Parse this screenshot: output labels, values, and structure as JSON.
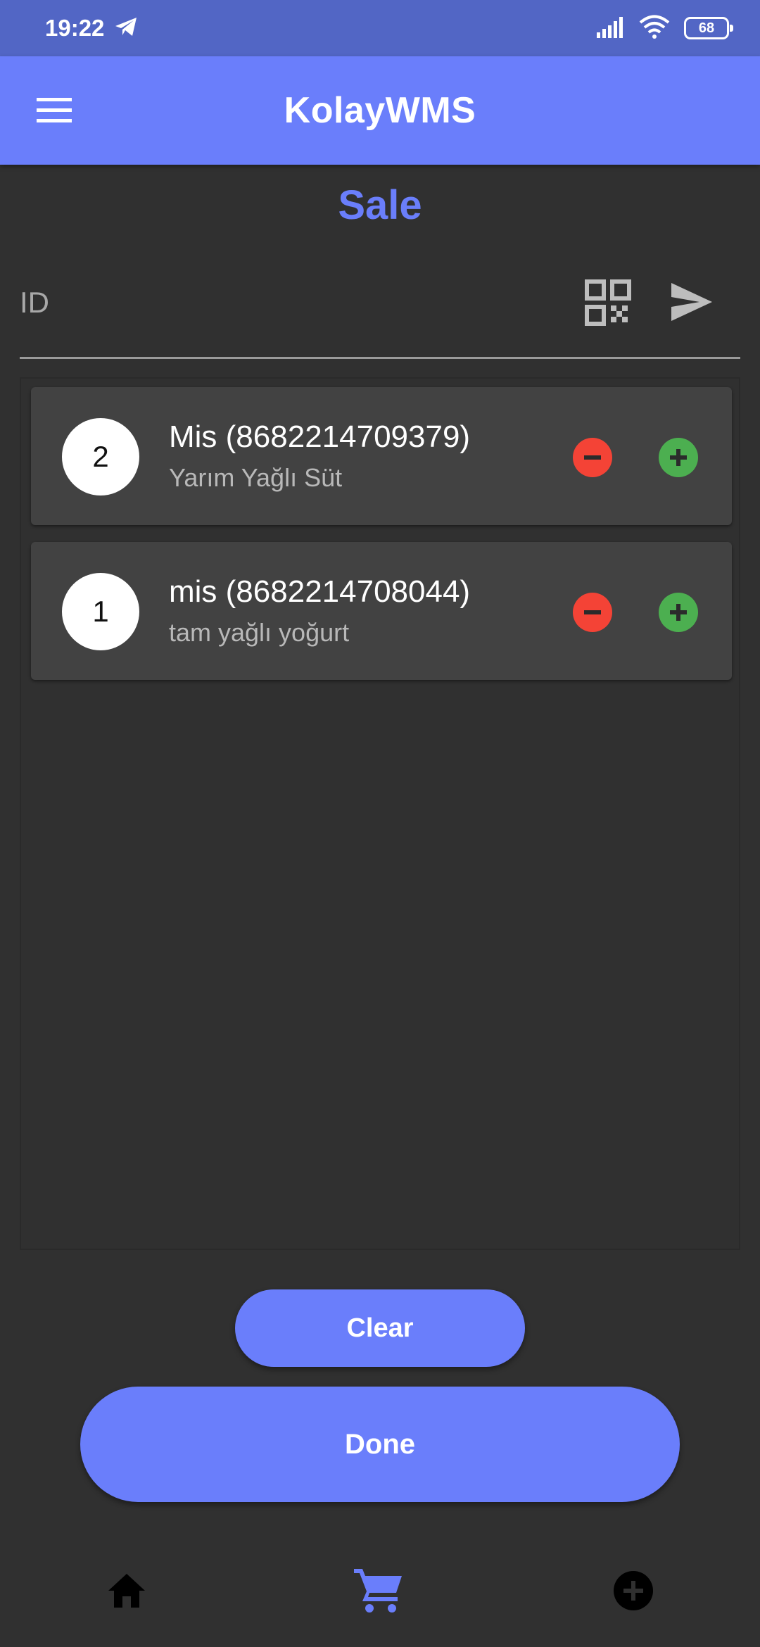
{
  "status_bar": {
    "time": "19:22",
    "battery": "68",
    "icons": [
      "telegram-icon",
      "signal-icon",
      "wifi-icon",
      "battery-icon"
    ]
  },
  "app_bar": {
    "title": "KolayWMS",
    "menu_icon": "hamburger-menu-icon"
  },
  "page": {
    "title": "Sale"
  },
  "id_field": {
    "placeholder": "ID",
    "value": "",
    "qr_icon": "qr-code-icon",
    "send_icon": "send-icon"
  },
  "items": [
    {
      "qty": "2",
      "title": "Mis (8682214709379)",
      "subtitle": "Yarım Yağlı Süt"
    },
    {
      "qty": "1",
      "title": "mis (8682214708044)",
      "subtitle": "tam yağlı yoğurt"
    }
  ],
  "buttons": {
    "clear": "Clear",
    "done": "Done"
  },
  "bottom_nav": {
    "items": [
      "home-icon",
      "cart-icon",
      "add-circle-icon"
    ],
    "active": "cart-icon"
  },
  "colors": {
    "primary": "#6a7efb",
    "status_bar": "#5266c5",
    "background": "#303030",
    "card": "#424242",
    "minus": "#f44336",
    "plus": "#4caf50"
  }
}
